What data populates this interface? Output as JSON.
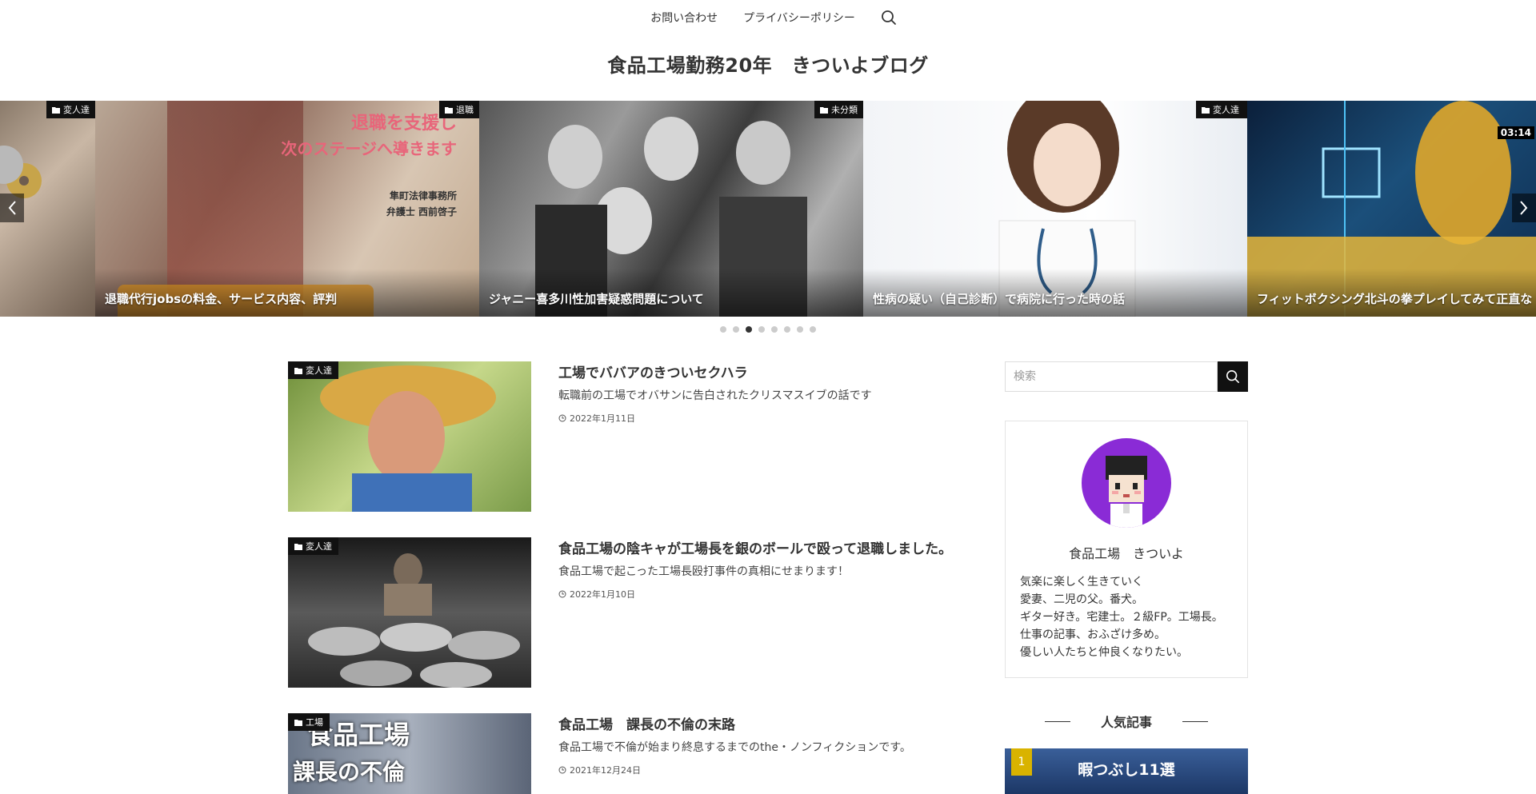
{
  "nav": {
    "items": [
      "お問い合わせ",
      "プライバシーポリシー"
    ]
  },
  "site": {
    "title": "食品工場勤務20年　きついよブログ"
  },
  "slider": {
    "slides": [
      {
        "category": "変人達",
        "caption": ""
      },
      {
        "category": "退職",
        "caption": "退職代行jobsの料金、サービス内容、評判",
        "image_text": [
          "退職を支援し",
          "次のステージへ導きます",
          "隼町法律事務所",
          "弁護士 西前啓子"
        ]
      },
      {
        "category": "未分類",
        "caption": "ジャニー喜多川性加害疑惑問題について"
      },
      {
        "category": "変人達",
        "caption": "性病の疑い（自己診断）で病院に行った時の話"
      },
      {
        "category": "",
        "caption": "フィットボクシング北斗の拳プレイしてみて正直な",
        "image_text": [
          "03:14"
        ]
      }
    ],
    "dot_count": 8,
    "active_dot": 2
  },
  "posts": [
    {
      "category": "変人達",
      "title": "工場でババアのきついセクハラ",
      "excerpt": "転職前の工場でオバサンに告白されたクリスマスイブの話です",
      "date": "2022年1月11日"
    },
    {
      "category": "変人達",
      "title": "食品工場の陰キャが工場長を銀のボールで殴って退職しました。",
      "excerpt": "食品工場で起こった工場長殴打事件の真相にせまります！",
      "date": "2022年1月10日"
    },
    {
      "category": "工場",
      "title": "食品工場　課長の不倫の末路",
      "excerpt": "食品工場で不倫が始まり終息するまでのthe・ノンフィクションです。",
      "date": "2021年12月24日",
      "image_text": [
        "食品工場",
        "課長の不倫"
      ]
    }
  ],
  "sidebar": {
    "search_placeholder": "検索",
    "profile": {
      "name": "食品工場　きついよ",
      "bio": [
        "気楽に楽しく生きていく",
        "愛妻、二児の父。番犬。",
        "ギター好き。宅建士。２級FP。工場長。",
        "仕事の記事、おふざけ多め。",
        "優しい人たちと仲良くなりたい。"
      ]
    },
    "popular_title": "人気記事",
    "popular": [
      {
        "rank": "1",
        "image_text": "暇つぶし11選"
      }
    ]
  },
  "colors": {
    "category_badge": "#111111",
    "avatar_bg": "#8a2bd6",
    "rank_badge": "#d9b300"
  }
}
